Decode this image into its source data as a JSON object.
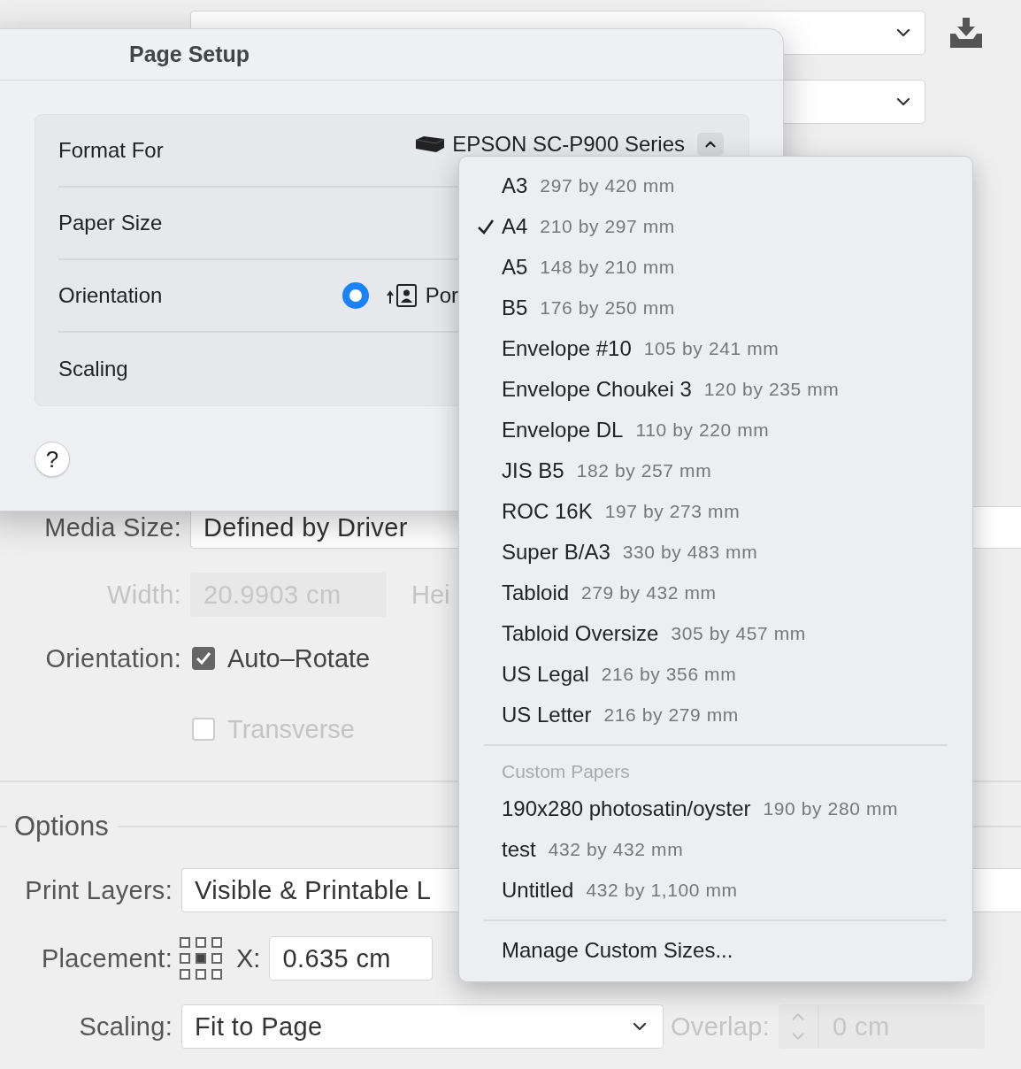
{
  "print_panel": {
    "media_size": {
      "label": "Media Size:",
      "value": "Defined by Driver"
    },
    "width": {
      "label": "Width:",
      "value": "20.9903 cm",
      "disabled": true
    },
    "height_label": "Hei",
    "orientation": {
      "label": "Orientation:",
      "options": [
        {
          "label": "Auto–Rotate",
          "checked": true,
          "disabled": false
        },
        {
          "label": "Transverse",
          "checked": false,
          "disabled": true
        }
      ]
    },
    "options": {
      "title": "Options",
      "print_layers": {
        "label": "Print Layers:",
        "value": "Visible & Printable L"
      },
      "placement": {
        "label": "Placement:",
        "x_label": "X:",
        "x_value": "0.635 cm"
      },
      "scaling": {
        "label": "Scaling:",
        "value": "Fit to Page"
      },
      "overlap": {
        "label": "Overlap:",
        "value": "0 cm",
        "disabled": true
      }
    }
  },
  "page_setup": {
    "title": "Page Setup",
    "rows": [
      {
        "label": "Format For",
        "kind": "printer",
        "value": "EPSON SC-P900 Series"
      },
      {
        "label": "Paper Size",
        "kind": "empty"
      },
      {
        "label": "Orientation",
        "kind": "radio",
        "value": "Por",
        "selected": true
      },
      {
        "label": "Scaling",
        "kind": "empty"
      }
    ],
    "help": "?"
  },
  "paper_menu": {
    "items": [
      {
        "name": "A3",
        "size": "297 by 420 mm",
        "selected": false
      },
      {
        "name": "A4",
        "size": "210 by 297 mm",
        "selected": true
      },
      {
        "name": "A5",
        "size": "148 by 210 mm",
        "selected": false
      },
      {
        "name": "B5",
        "size": "176 by 250 mm",
        "selected": false
      },
      {
        "name": "Envelope #10",
        "size": "105 by 241 mm",
        "selected": false
      },
      {
        "name": "Envelope Choukei 3",
        "size": "120 by 235 mm",
        "selected": false
      },
      {
        "name": "Envelope DL",
        "size": "110 by 220 mm",
        "selected": false
      },
      {
        "name": "JIS B5",
        "size": "182 by 257 mm",
        "selected": false
      },
      {
        "name": "ROC 16K",
        "size": "197 by 273 mm",
        "selected": false
      },
      {
        "name": "Super B/A3",
        "size": "330 by 483 mm",
        "selected": false
      },
      {
        "name": "Tabloid",
        "size": "279 by 432 mm",
        "selected": false
      },
      {
        "name": "Tabloid Oversize",
        "size": "305 by 457 mm",
        "selected": false
      },
      {
        "name": "US Legal",
        "size": "216 by 356 mm",
        "selected": false
      },
      {
        "name": "US Letter",
        "size": "216 by 279 mm",
        "selected": false
      }
    ],
    "custom_header": "Custom Papers",
    "custom_items": [
      {
        "name": "190x280 photosatin/oyster",
        "size": "190 by 280 mm",
        "selected": false
      },
      {
        "name": "test",
        "size": "432 by 432 mm",
        "selected": false
      },
      {
        "name": "Untitled",
        "size": "432 by 1,100 mm",
        "selected": false
      }
    ],
    "manage": "Manage Custom Sizes..."
  }
}
